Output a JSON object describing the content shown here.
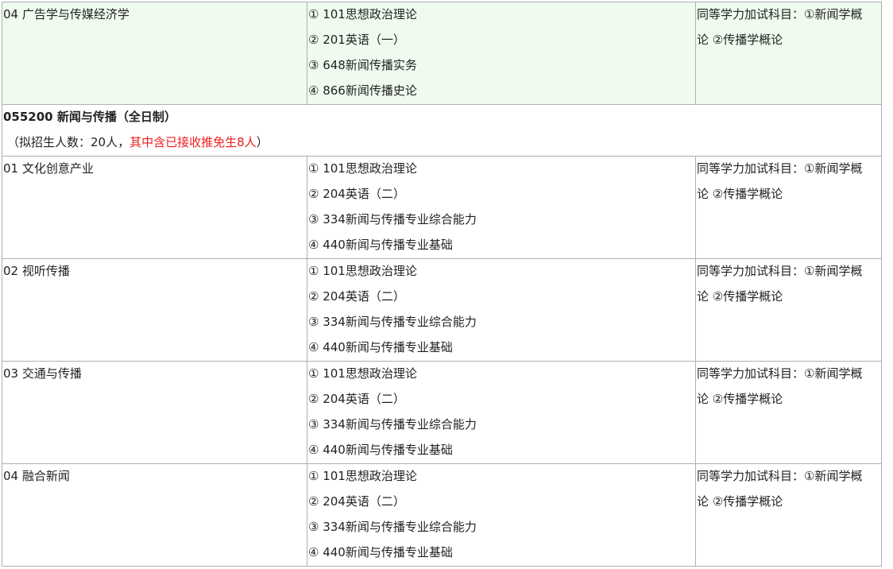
{
  "rows": [
    {
      "direction": "04 广告学与传媒经济学",
      "subjects": [
        "① 101思想政治理论",
        "② 201英语（一）",
        "③ 648新闻传播实务",
        "④ 866新闻传播史论"
      ],
      "note_line1": "同等学力加试科目：①新闻学概",
      "note_line2": "论 ②传播学概论"
    }
  ],
  "major": {
    "title": "055200 新闻与传播（全日制）",
    "enroll_prefix": "（拟招生人数：20人，",
    "enroll_red": "其中含已接收推免生8人",
    "enroll_suffix": "）"
  },
  "directions": [
    {
      "direction": "01 文化创意产业",
      "subjects": [
        "① 101思想政治理论",
        "② 204英语（二）",
        "③ 334新闻与传播专业综合能力",
        "④ 440新闻与传播专业基础"
      ],
      "note_line1": "同等学力加试科目：①新闻学概",
      "note_line2": "论 ②传播学概论"
    },
    {
      "direction": "02 视听传播",
      "subjects": [
        "① 101思想政治理论",
        "② 204英语（二）",
        "③ 334新闻与传播专业综合能力",
        "④ 440新闻与传播专业基础"
      ],
      "note_line1": "同等学力加试科目：①新闻学概",
      "note_line2": "论 ②传播学概论"
    },
    {
      "direction": "03 交通与传播",
      "subjects": [
        "① 101思想政治理论",
        "② 204英语（二）",
        "③ 334新闻与传播专业综合能力",
        "④ 440新闻与传播专业基础"
      ],
      "note_line1": "同等学力加试科目：①新闻学概",
      "note_line2": "论 ②传播学概论"
    },
    {
      "direction": "04 融合新闻",
      "subjects": [
        "① 101思想政治理论",
        "② 204英语（二）",
        "③ 334新闻与传播专业综合能力",
        "④ 440新闻与传播专业基础"
      ],
      "note_line1": "同等学力加试科目：①新闻学概",
      "note_line2": "论 ②传播学概论"
    }
  ]
}
